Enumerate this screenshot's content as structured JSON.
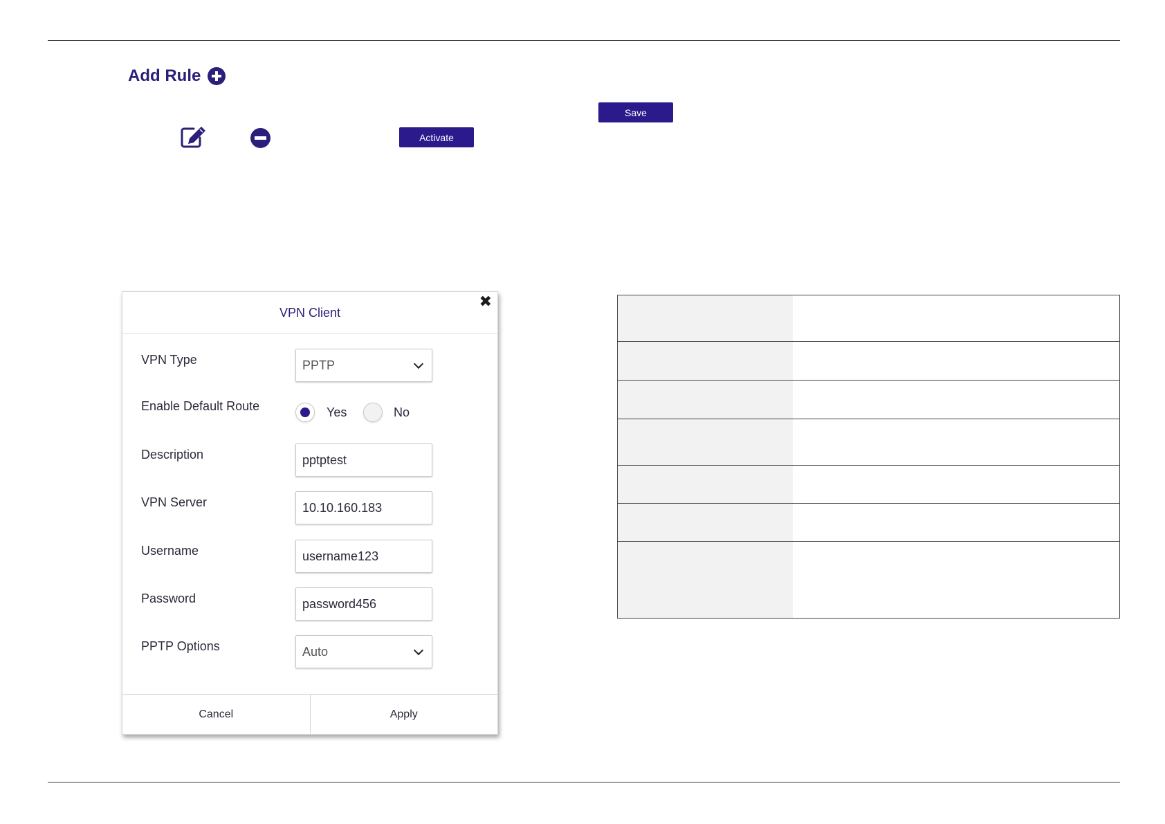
{
  "page": {
    "add_rule_label": "Add Rule",
    "save_label": "Save",
    "activate_label": "Activate"
  },
  "dialog": {
    "title": "VPN Client",
    "close_glyph": "✖",
    "fields": {
      "vpn_type_label": "VPN Type",
      "vpn_type_value": "PPTP",
      "default_route_label": "Enable Default Route",
      "default_route_yes": "Yes",
      "default_route_no": "No",
      "default_route_selected": "Yes",
      "description_label": "Description",
      "description_value": "pptptest",
      "vpn_server_label": "VPN Server",
      "vpn_server_value": "10.10.160.183",
      "username_label": "Username",
      "username_value": "username123",
      "password_label": "Password",
      "password_value": "password456",
      "pptp_options_label": "PPTP Options",
      "pptp_options_value": "Auto"
    },
    "cancel_label": "Cancel",
    "apply_label": "Apply"
  },
  "colors": {
    "accent": "#2b1a8c",
    "table_shade": "#f2f2f2"
  },
  "icons": [
    "circle-plus-icon",
    "edit-icon",
    "circle-minus-icon",
    "close-icon",
    "chevron-down-icon"
  ]
}
